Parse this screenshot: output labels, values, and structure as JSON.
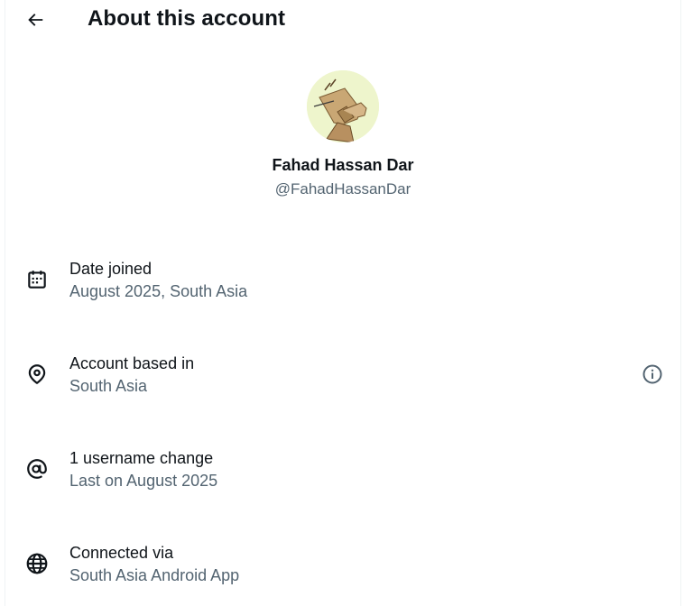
{
  "header": {
    "title": "About this account",
    "back_icon": "arrow-left-icon"
  },
  "profile": {
    "display_name": "Fahad Hassan Dar",
    "handle": "@FahadHassanDar"
  },
  "rows": [
    {
      "icon": "calendar-icon",
      "label": "Date joined",
      "value": "August 2025, South Asia"
    },
    {
      "icon": "location-pin-icon",
      "label": "Account based in",
      "value": "South Asia",
      "trailing_icon": "info-icon"
    },
    {
      "icon": "at-sign-icon",
      "label": "1 username change",
      "value": "Last on August 2025"
    },
    {
      "icon": "globe-icon",
      "label": "Connected via",
      "value": "South Asia Android App"
    }
  ],
  "colors": {
    "primary_text": "#0f1419",
    "secondary_text": "#536471",
    "border": "#eff3f4"
  }
}
